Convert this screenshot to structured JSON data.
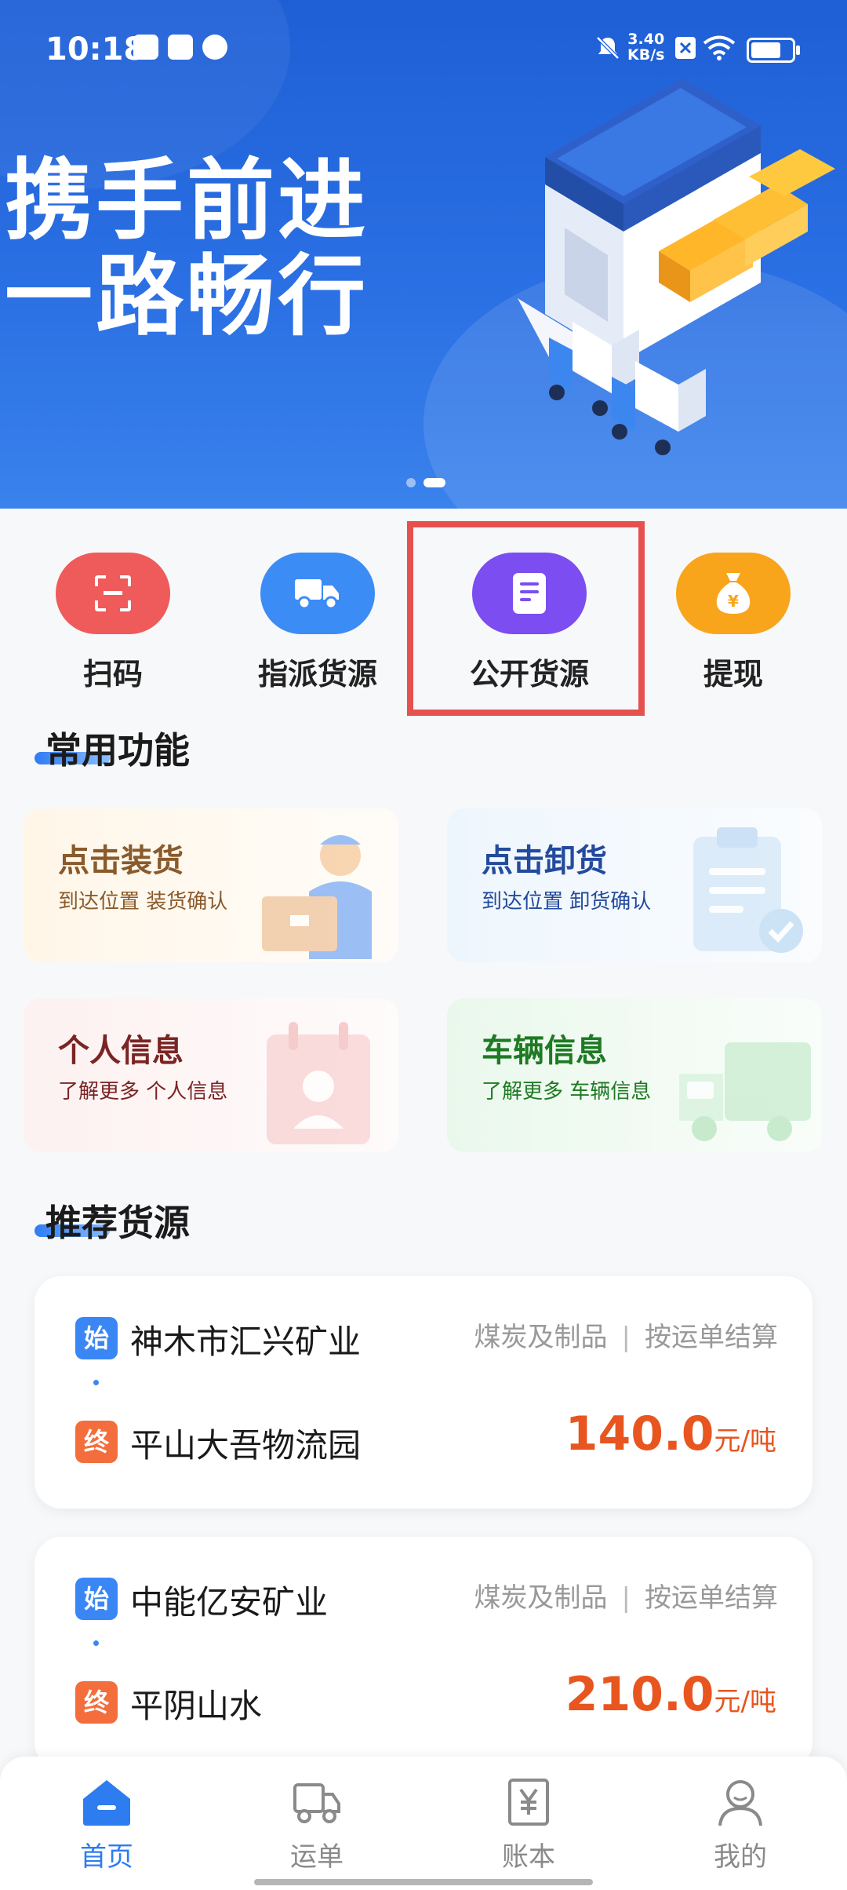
{
  "status_bar": {
    "time": "10:18",
    "net_speed_value": "3.40",
    "net_speed_unit": "KB/s",
    "battery_level": 0.85
  },
  "banner": {
    "slogan_line1": "携手前进",
    "slogan_line2": "一路畅行",
    "slide_count": 2,
    "active_slide": 2
  },
  "quick_actions": [
    {
      "label": "扫码",
      "icon": "scan-icon",
      "color": "#ef5a5a"
    },
    {
      "label": "指派货源",
      "icon": "truck-icon",
      "color": "#3b8cf5"
    },
    {
      "label": "公开货源",
      "icon": "document-icon",
      "color": "#7c4df0"
    },
    {
      "label": "提现",
      "icon": "money-bag-icon",
      "color": "#f8a51b"
    }
  ],
  "common_functions": {
    "title": "常用功能",
    "cards": [
      {
        "title": "点击装货",
        "subtitle": "到达位置 装货确认",
        "title_color": "#8a5a2b",
        "bg": "#fff6e8",
        "icon": "loading-worker-icon"
      },
      {
        "title": "点击卸货",
        "subtitle": "到达位置 卸货确认",
        "title_color": "#234a9c",
        "bg": "#eef6fd",
        "icon": "clipboard-check-icon"
      },
      {
        "title": "个人信息",
        "subtitle": "了解更多 个人信息",
        "title_color": "#7a2424",
        "bg": "#fdf1f1",
        "icon": "id-card-icon"
      },
      {
        "title": "车辆信息",
        "subtitle": "了解更多 车辆信息",
        "title_color": "#1e7a23",
        "bg": "#eaf8ec",
        "icon": "vehicle-icon"
      }
    ]
  },
  "recommended": {
    "title": "推荐货源",
    "start_tag": "始",
    "end_tag": "终",
    "items": [
      {
        "from": "神木市汇兴矿业",
        "to": "平山大吾物流园",
        "category": "煤炭及制品",
        "separator": "|",
        "settlement": "按运单结算",
        "price": "140.0",
        "unit": "元/吨"
      },
      {
        "from": "中能亿安矿业",
        "to": "平阴山水",
        "category": "煤炭及制品",
        "separator": "|",
        "settlement": "按运单结算",
        "price": "210.0",
        "unit": "元/吨"
      }
    ]
  },
  "bottom_nav": [
    {
      "label": "首页",
      "icon": "home-icon",
      "active": true
    },
    {
      "label": "运单",
      "icon": "waybill-truck-icon",
      "active": false
    },
    {
      "label": "账本",
      "icon": "ledger-yen-icon",
      "active": false
    },
    {
      "label": "我的",
      "icon": "profile-icon",
      "active": false
    }
  ],
  "colors": {
    "accent": "#2d7cf0",
    "price": "#e8551f",
    "highlight": "#e5514f"
  }
}
